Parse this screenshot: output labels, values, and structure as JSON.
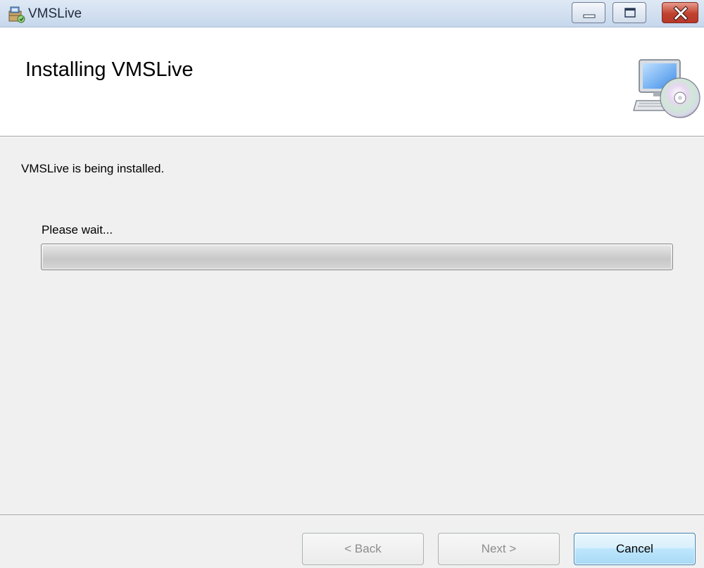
{
  "window": {
    "title": "VMSLive",
    "icon": "installer-icon",
    "controls": [
      "minimize-icon",
      "maximize-icon",
      "close-icon"
    ]
  },
  "header": {
    "title": "Installing VMSLive",
    "icon": "computer-cd-icon"
  },
  "body": {
    "status_text": "VMSLive is being installed.",
    "wait_label": "Please wait...",
    "progress_fraction": 0.0
  },
  "buttons": {
    "back_label": "< Back",
    "back_enabled": false,
    "next_label": "Next >",
    "next_enabled": false,
    "cancel_label": "Cancel",
    "cancel_enabled": true
  },
  "colors": {
    "title_bar": "#c6d7ec",
    "close_button": "#c1412e",
    "dialog_background": "#f0f0f0",
    "header_background": "#ffffff",
    "default_button_border": "#3c7fb1"
  }
}
